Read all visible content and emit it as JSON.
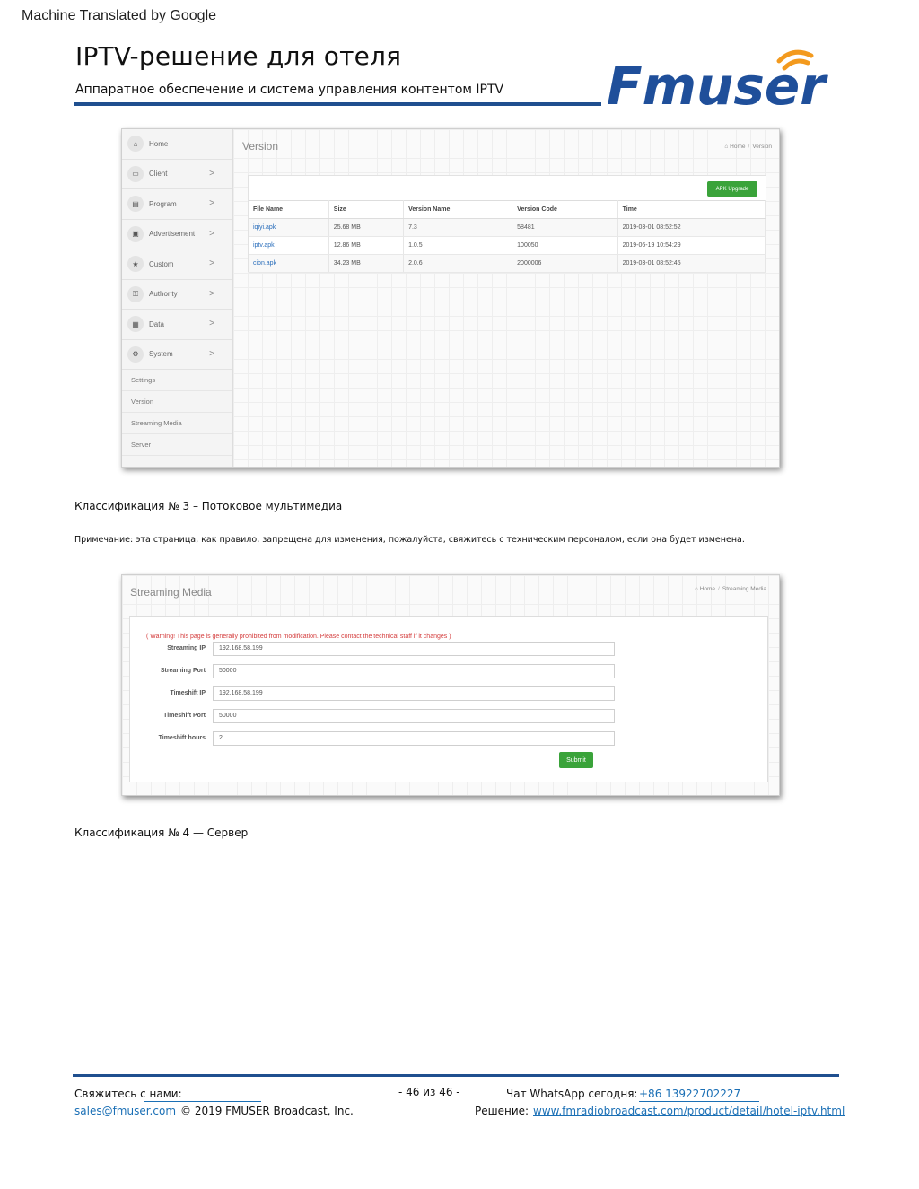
{
  "banner": "Machine Translated by Google",
  "header": {
    "title": "IPTV-решение для отеля",
    "subtitle": "Аппаратное обеспечение и система управления контентом IPTV",
    "logo_text": "Fmuser"
  },
  "version_screen": {
    "sidebar": [
      {
        "label": "Home",
        "icon": "home-icon",
        "chevron": ""
      },
      {
        "label": "Client",
        "icon": "monitor-icon",
        "chevron": ">"
      },
      {
        "label": "Program",
        "icon": "film-icon",
        "chevron": ">"
      },
      {
        "label": "Advertisement",
        "icon": "image-icon",
        "chevron": ">"
      },
      {
        "label": "Custom",
        "icon": "star-icon",
        "chevron": ">"
      },
      {
        "label": "Authority",
        "icon": "key-icon",
        "chevron": ">"
      },
      {
        "label": "Data",
        "icon": "chart-icon",
        "chevron": ">"
      },
      {
        "label": "System",
        "icon": "gear-icon",
        "chevron": ">"
      }
    ],
    "subitems": [
      "Settings",
      "Version",
      "Streaming Media",
      "Server"
    ],
    "page_title": "Version",
    "breadcrumb": {
      "home": "Home",
      "current": "Version"
    },
    "apk_button": "APK Upgrade",
    "columns": [
      "File Name",
      "Size",
      "Version Name",
      "Version Code",
      "Time"
    ],
    "rows": [
      [
        "iqiyi.apk",
        "25.68 MB",
        "7.3",
        "58481",
        "2019-03-01 08:52:52"
      ],
      [
        "iptv.apk",
        "12.86 MB",
        "1.0.5",
        "100050",
        "2019-06-19 10:54:29"
      ],
      [
        "cibn.apk",
        "34.23 MB",
        "2.0.6",
        "2000006",
        "2019-03-01 08:52:45"
      ]
    ]
  },
  "caption3": "Классификация № 3 – Потоковое мультимедиа",
  "note": "Примечание: эта страница, как правило, запрещена для изменения, пожалуйста, свяжитесь с техническим персоналом, если она будет изменена.",
  "streaming_screen": {
    "page_title": "Streaming Media",
    "breadcrumb": {
      "home": "Home",
      "current": "Streaming Media"
    },
    "warning": "( Warning! This page is generally prohibited from modification. Please contact the technical staff if it changes )",
    "fields": [
      {
        "label": "Streaming IP",
        "value": "192.168.58.199"
      },
      {
        "label": "Streaming Port",
        "value": "50000"
      },
      {
        "label": "Timeshift IP",
        "value": "192.168.58.199"
      },
      {
        "label": "Timeshift Port",
        "value": "50000"
      },
      {
        "label": "Timeshift hours",
        "value": "2"
      }
    ],
    "submit": "Submit"
  },
  "caption4": "Классификация № 4 — Сервер",
  "footer": {
    "contact_label": "Свяжитесь с нами:",
    "email": "sales@fmuser.com",
    "copyright": "© 2019 FMUSER Broadcast, Inc.",
    "page": "- 46 из 46 -",
    "whatsapp_label": "Чат WhatsApp сегодня:",
    "whatsapp_number": "+86 13922702227",
    "solution_label": "Решение:",
    "solution_url": "www.fmradiobroadcast.com/product/detail/hotel-iptv.html"
  },
  "colors": {
    "accent": "#1f4f8f",
    "link": "#1a6fb5",
    "button_green": "#3aa33a",
    "warning_red": "#d43c3c"
  }
}
